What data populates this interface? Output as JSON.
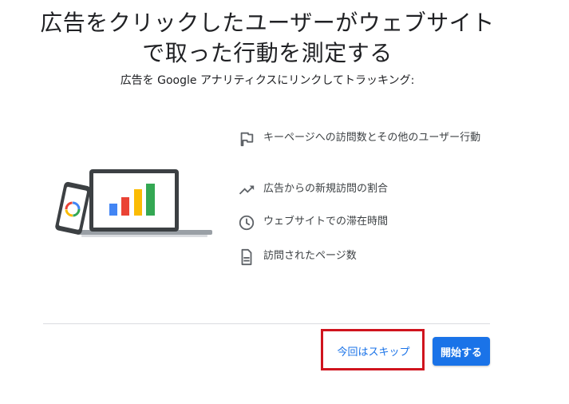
{
  "dialog": {
    "title_line1": "広告をクリックしたユーザーがウェブサイト",
    "title_line2": "で取った行動を測定する",
    "subtitle": "広告を Google アナリティクスにリンクしてトラッキング:"
  },
  "features": [
    {
      "icon": "flag-icon",
      "text": "キーページへの訪問数とその他のユーザー行動"
    },
    {
      "icon": "trending-up-icon",
      "text": "広告からの新規訪問の割合"
    },
    {
      "icon": "clock-icon",
      "text": "ウェブサイトでの滞在時間"
    },
    {
      "icon": "document-icon",
      "text": "訪問されたページ数"
    }
  ],
  "actions": {
    "skip_label": "今回はスキップ",
    "start_label": "開始する"
  },
  "colors": {
    "primary": "#1a73e8",
    "highlight": "#d0141e",
    "icon": "#5f6368",
    "bar_blue": "#4285f4",
    "bar_red": "#ea4335",
    "bar_yellow": "#fbbc04",
    "bar_green": "#34a853"
  }
}
